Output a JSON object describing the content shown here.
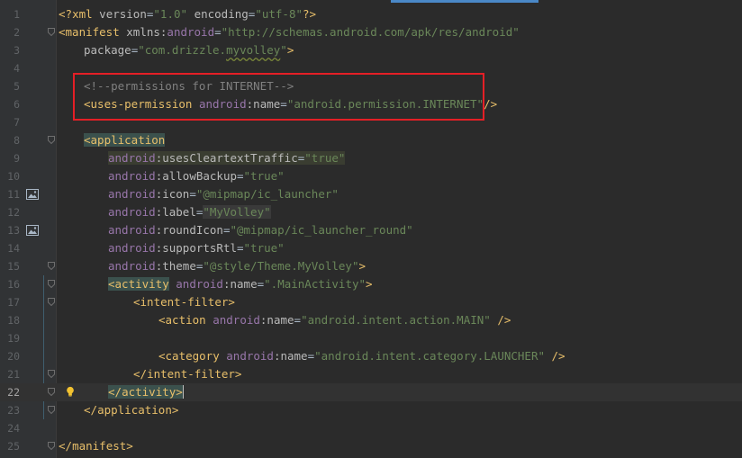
{
  "editor": {
    "lines": [
      {
        "n": "1",
        "tokens": [
          [
            "t-punct",
            "<?"
          ],
          [
            "t-tag",
            "xml "
          ],
          [
            "t-attr",
            "version"
          ],
          [
            "t-plain",
            "="
          ],
          [
            "t-val",
            "\"1.0\""
          ],
          [
            "t-plain",
            " "
          ],
          [
            "t-attr",
            "encoding"
          ],
          [
            "t-plain",
            "="
          ],
          [
            "t-val",
            "\"utf-8\""
          ],
          [
            "t-punct",
            "?>"
          ]
        ]
      },
      {
        "n": "2",
        "tokens": [
          [
            "t-punct",
            "<"
          ],
          [
            "t-tag",
            "manifest "
          ],
          [
            "t-attr",
            "xmlns:"
          ],
          [
            "t-ns",
            "android"
          ],
          [
            "t-plain",
            "="
          ],
          [
            "t-val",
            "\"http://schemas.android.com/apk/res/android\""
          ]
        ]
      },
      {
        "n": "3",
        "tokens": [
          [
            "t-attr",
            "package"
          ],
          [
            "t-plain",
            "="
          ],
          [
            "t-val",
            "\"com.drizzle."
          ],
          [
            "t-val squig",
            "myvolley"
          ],
          [
            "t-val",
            "\""
          ],
          [
            "t-punct",
            ">"
          ]
        ]
      },
      {
        "n": "4",
        "tokens": []
      },
      {
        "n": "5",
        "tokens": [
          [
            "t-comment",
            "<!--permissions for INTERNET-->"
          ]
        ]
      },
      {
        "n": "6",
        "tokens": [
          [
            "t-punct",
            "<"
          ],
          [
            "t-tag",
            "uses-permission "
          ],
          [
            "t-ns",
            "android"
          ],
          [
            "t-attr",
            ":name"
          ],
          [
            "t-plain",
            "="
          ],
          [
            "t-val",
            "\"android.permission.INTERNET\""
          ],
          [
            "t-punct",
            "/>"
          ]
        ]
      },
      {
        "n": "7",
        "tokens": []
      },
      {
        "n": "8",
        "tokens": [
          [
            "t-punct hl-tag",
            "<"
          ],
          [
            "t-tag hl-tag",
            "application"
          ]
        ]
      },
      {
        "n": "9",
        "tokens": [
          [
            "t-ns hl2",
            "android"
          ],
          [
            "t-attr hl2",
            ":usesCleartextTraffic"
          ],
          [
            "t-plain hl2",
            "="
          ],
          [
            "t-val hl2",
            "\"true\""
          ]
        ]
      },
      {
        "n": "10",
        "tokens": [
          [
            "t-ns",
            "android"
          ],
          [
            "t-attr",
            ":allowBackup"
          ],
          [
            "t-plain",
            "="
          ],
          [
            "t-val",
            "\"true\""
          ]
        ]
      },
      {
        "n": "11",
        "tokens": [
          [
            "t-ns",
            "android"
          ],
          [
            "t-attr",
            ":icon"
          ],
          [
            "t-plain",
            "="
          ],
          [
            "t-val",
            "\"@mipmap/ic_launcher\""
          ]
        ]
      },
      {
        "n": "12",
        "tokens": [
          [
            "t-ns",
            "android"
          ],
          [
            "t-attr",
            ":label"
          ],
          [
            "t-plain",
            "="
          ],
          [
            "t-val hl3",
            "\"MyVolley\""
          ]
        ]
      },
      {
        "n": "13",
        "tokens": [
          [
            "t-ns",
            "android"
          ],
          [
            "t-attr",
            ":roundIcon"
          ],
          [
            "t-plain",
            "="
          ],
          [
            "t-val",
            "\"@mipmap/ic_launcher_round\""
          ]
        ]
      },
      {
        "n": "14",
        "tokens": [
          [
            "t-ns",
            "android"
          ],
          [
            "t-attr",
            ":supportsRtl"
          ],
          [
            "t-plain",
            "="
          ],
          [
            "t-val",
            "\"true\""
          ]
        ]
      },
      {
        "n": "15",
        "tokens": [
          [
            "t-ns",
            "android"
          ],
          [
            "t-attr",
            ":theme"
          ],
          [
            "t-plain",
            "="
          ],
          [
            "t-val",
            "\"@style/Theme.MyVolley\""
          ],
          [
            "t-punct",
            ">"
          ]
        ]
      },
      {
        "n": "16",
        "tokens": [
          [
            "t-punct hl-tag",
            "<"
          ],
          [
            "t-tag hl-tag",
            "activity"
          ],
          [
            "t-plain",
            " "
          ],
          [
            "t-ns",
            "android"
          ],
          [
            "t-attr",
            ":name"
          ],
          [
            "t-plain",
            "="
          ],
          [
            "t-val",
            "\".MainActivity\""
          ],
          [
            "t-punct",
            ">"
          ]
        ]
      },
      {
        "n": "17",
        "tokens": [
          [
            "t-punct",
            "<"
          ],
          [
            "t-tag",
            "intent-filter"
          ],
          [
            "t-punct",
            ">"
          ]
        ]
      },
      {
        "n": "18",
        "tokens": [
          [
            "t-punct",
            "<"
          ],
          [
            "t-tag",
            "action "
          ],
          [
            "t-ns",
            "android"
          ],
          [
            "t-attr",
            ":name"
          ],
          [
            "t-plain",
            "="
          ],
          [
            "t-val",
            "\"android.intent.action.MAIN\""
          ],
          [
            "t-plain",
            " "
          ],
          [
            "t-punct",
            "/>"
          ]
        ]
      },
      {
        "n": "19",
        "tokens": []
      },
      {
        "n": "20",
        "tokens": [
          [
            "t-punct",
            "<"
          ],
          [
            "t-tag",
            "category "
          ],
          [
            "t-ns",
            "android"
          ],
          [
            "t-attr",
            ":name"
          ],
          [
            "t-plain",
            "="
          ],
          [
            "t-val",
            "\"android.intent.category.LAUNCHER\""
          ],
          [
            "t-plain",
            " "
          ],
          [
            "t-punct",
            "/>"
          ]
        ]
      },
      {
        "n": "21",
        "tokens": [
          [
            "t-punct",
            "</"
          ],
          [
            "t-tag",
            "intent-filter"
          ],
          [
            "t-punct",
            ">"
          ]
        ]
      },
      {
        "n": "22",
        "tokens": [
          [
            "t-punct hl-tag",
            "</"
          ],
          [
            "t-tag hl-tag",
            "activity"
          ],
          [
            "t-punct hl-tag",
            ">"
          ]
        ]
      },
      {
        "n": "23",
        "tokens": [
          [
            "t-punct",
            "</"
          ],
          [
            "t-tag",
            "application"
          ],
          [
            "t-punct",
            ">"
          ]
        ]
      },
      {
        "n": "24",
        "tokens": []
      },
      {
        "n": "25",
        "tokens": [
          [
            "t-punct",
            "</"
          ],
          [
            "t-tag",
            "manifest"
          ],
          [
            "t-punct",
            ">"
          ]
        ]
      }
    ]
  },
  "colors": {
    "background": "#2b2b2b",
    "gutter": "#313335",
    "highlight_box": "#e41f26",
    "tag": "#e8bf6a",
    "string": "#6a8759",
    "namespace": "#9876aa",
    "comment": "#808080"
  },
  "icons": {
    "image_gutter": "image-icon",
    "intention_bulb": "lightbulb-icon",
    "fold_marker": "fold-icon"
  }
}
